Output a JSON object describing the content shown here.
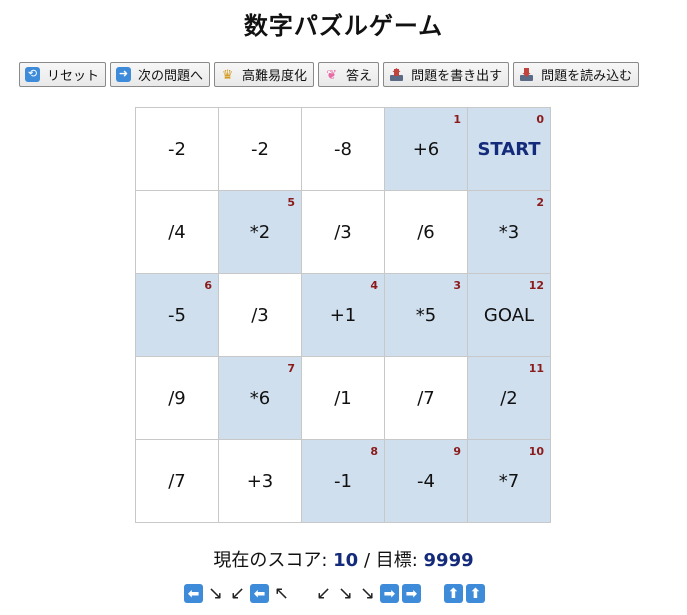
{
  "title": "数字パズルゲーム",
  "toolbar": {
    "reset": "リセット",
    "next": "次の問題へ",
    "harder": "高難易度化",
    "answer": "答え",
    "export": "問題を書き出す",
    "import": "問題を読み込む"
  },
  "icons": {
    "reset": "repeat-icon",
    "next": "arrow-right-icon",
    "harder": "crown-icon",
    "answer": "brain-icon",
    "export": "outbox-tray-icon",
    "import": "inbox-tray-icon"
  },
  "board": {
    "rows": [
      [
        {
          "op": "-2",
          "step": ""
        },
        {
          "op": "-2",
          "step": ""
        },
        {
          "op": "-8",
          "step": ""
        },
        {
          "op": "+6",
          "step": "1"
        },
        {
          "op": "START",
          "step": "0"
        }
      ],
      [
        {
          "op": "/4",
          "step": ""
        },
        {
          "op": "*2",
          "step": "5"
        },
        {
          "op": "/3",
          "step": ""
        },
        {
          "op": "/6",
          "step": ""
        },
        {
          "op": "*3",
          "step": "2"
        }
      ],
      [
        {
          "op": "-5",
          "step": "6"
        },
        {
          "op": "/3",
          "step": ""
        },
        {
          "op": "+1",
          "step": "4"
        },
        {
          "op": "*5",
          "step": "3"
        },
        {
          "op": "GOAL",
          "step": "12"
        }
      ],
      [
        {
          "op": "/9",
          "step": ""
        },
        {
          "op": "*6",
          "step": "7"
        },
        {
          "op": "/1",
          "step": ""
        },
        {
          "op": "/7",
          "step": ""
        },
        {
          "op": "/2",
          "step": "11"
        }
      ],
      [
        {
          "op": "/7",
          "step": ""
        },
        {
          "op": "+3",
          "step": ""
        },
        {
          "op": "-1",
          "step": "8"
        },
        {
          "op": "-4",
          "step": "9"
        },
        {
          "op": "*7",
          "step": "10"
        }
      ]
    ],
    "path_color": "#cfdfee",
    "step_color": "#8b1a1a"
  },
  "score": {
    "label": "現在のスコア: ",
    "value": "10",
    "separator": " / 目標: ",
    "target": "9999"
  },
  "moves": [
    {
      "glyph": "⬅",
      "style": "box",
      "name": "left-arrow-icon"
    },
    {
      "glyph": "↘",
      "style": "plain",
      "name": "down-right-arrow-icon"
    },
    {
      "glyph": "↙",
      "style": "plain",
      "name": "down-left-arrow-icon"
    },
    {
      "glyph": "⬅",
      "style": "box",
      "name": "left-arrow-icon"
    },
    {
      "glyph": "↖",
      "style": "plain",
      "name": "up-left-arrow-icon"
    },
    {
      "glyph": "",
      "style": "gap",
      "name": "move-gap"
    },
    {
      "glyph": "↙",
      "style": "plain",
      "name": "down-left-arrow-icon"
    },
    {
      "glyph": "↘",
      "style": "plain",
      "name": "down-right-arrow-icon"
    },
    {
      "glyph": "↘",
      "style": "plain",
      "name": "down-right-arrow-icon"
    },
    {
      "glyph": "➡",
      "style": "box",
      "name": "right-arrow-icon"
    },
    {
      "glyph": "➡",
      "style": "box",
      "name": "right-arrow-icon"
    },
    {
      "glyph": "",
      "style": "gap",
      "name": "move-gap"
    },
    {
      "glyph": "⬆",
      "style": "box",
      "name": "up-arrow-icon"
    },
    {
      "glyph": "⬆",
      "style": "box",
      "name": "up-arrow-icon"
    }
  ]
}
